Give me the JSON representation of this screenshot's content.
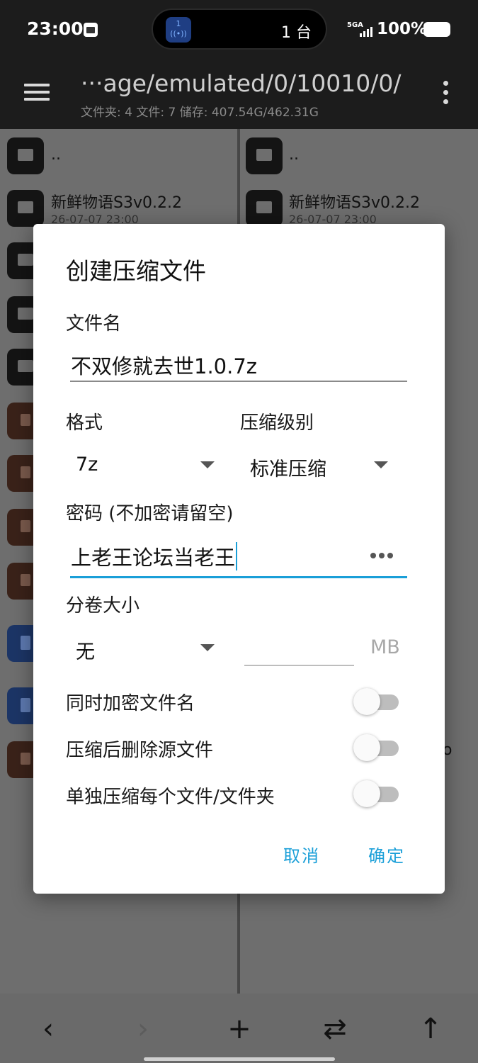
{
  "status_bar": {
    "time": "23:00",
    "hotspot_label": "1",
    "device_count": "1 台",
    "network": "5GA",
    "battery": "100%",
    "icons": [
      "app-notification-icon",
      "hotspot-icon",
      "signal-icon",
      "battery-icon"
    ]
  },
  "toolbar": {
    "path": "···age/emulated/0/10010/0/",
    "info": "文件夹: 4  文件: 7  储存: 407.54G/462.31G",
    "icons": [
      "menu-icon",
      "more-vert-icon"
    ]
  },
  "left_pane": {
    "items": [
      {
        "name": "..",
        "date": "",
        "icon": "folder-icon"
      },
      {
        "name": "新鲜物语S3v0.2.2",
        "date": "26-07-07 23:00",
        "icon": "folder-icon"
      }
    ]
  },
  "right_pane": {
    "items": [
      {
        "name": "..",
        "date": "",
        "icon": "folder-icon"
      },
      {
        "name": "新鲜物语S3v0.2.2",
        "date": "26-07-07 23:00",
        "icon": "folder-icon"
      }
    ],
    "trailing_char": "o"
  },
  "dialog": {
    "title": "创建压缩文件",
    "filename_label": "文件名",
    "filename_value": "不双修就去世1.0.7z",
    "format_label": "格式",
    "format_value": "7z",
    "level_label": "压缩级别",
    "level_value": "标准压缩",
    "password_label": "密码 (不加密请留空)",
    "password_value": "上老王论坛当老王",
    "volume_label": "分卷大小",
    "volume_value": "无",
    "volume_unit": "MB",
    "toggles": [
      {
        "label": "同时加密文件名",
        "on": false
      },
      {
        "label": "压缩后删除源文件",
        "on": false
      },
      {
        "label": "单独压缩每个文件/文件夹",
        "on": false
      }
    ],
    "cancel": "取消",
    "ok": "确定"
  },
  "bottom_bar": {
    "back": "‹",
    "forward": "›",
    "add": "+",
    "swap": "⇄",
    "up": "↑",
    "icons": [
      "back-arrow-icon",
      "forward-arrow-icon",
      "add-icon",
      "swap-icon",
      "up-arrow-icon"
    ]
  },
  "colors": {
    "accent": "#1a9fd8",
    "toolbar_bg": "#1c1c1c",
    "dialog_bg": "#ffffff",
    "scrim": "#6e6e6e"
  }
}
